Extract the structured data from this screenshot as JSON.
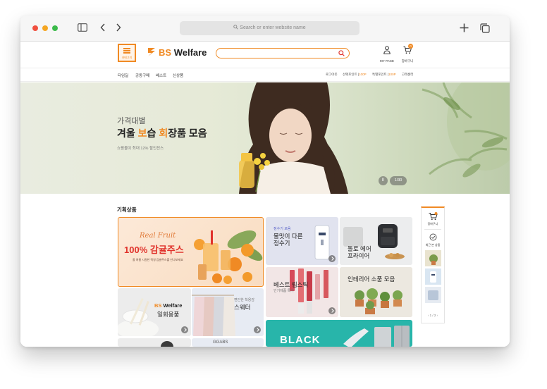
{
  "browser": {
    "address_placeholder": "Search or enter website name"
  },
  "header": {
    "category_label": "카테고리",
    "logo_prefix": "BS",
    "logo_text": "Welfare",
    "my_page": "MY PAGE",
    "cart": "장바구니",
    "cart_count": "0"
  },
  "nav": {
    "left": [
      "타임딜",
      "공동구매",
      "베스트",
      "신상품"
    ],
    "right": {
      "login": "로그아웃",
      "welfare_points_label": "선택포인트 |",
      "welfare_points_value": "100P",
      "special_points_label": "특별포인트 |",
      "special_points_value": "100P",
      "customer_center": "고객센터"
    }
  },
  "hero": {
    "subtitle": "가격대별",
    "title_part1": "겨울 ",
    "title_highlight1": "보",
    "title_part2": "습 ",
    "title_highlight2": "회",
    "title_part3": "장품 모음",
    "description": "쇼핑몰이 최대 12% 할인찬스",
    "pause_label": "II",
    "page_indicator": "1/30"
  },
  "section": {
    "title": "기획상품"
  },
  "tiles": {
    "juice": {
      "script": "Real Fruit",
      "headline": "100% 감귤주스",
      "note": "올 여름 시원한 직영 감귤주스를 만나보세요"
    },
    "water": {
      "prefix": "정수기 모음",
      "title1": "물맛이 다른",
      "title2": "정수기"
    },
    "fryer": {
      "title1": "돌로 에어",
      "title2": "프라이어"
    },
    "welfare": {
      "logo_prefix": "BS",
      "logo_text": "Welfare",
      "title": "일회용품"
    },
    "sweater": {
      "prefix": "편안한 착용감",
      "title": "스웨터"
    },
    "lipstick": {
      "title": "베스트 립스틱",
      "prefix": "인기제품 특가"
    },
    "interior": {
      "title": "인테리어 소품 모음"
    },
    "black": {
      "title": "BLACK"
    },
    "partial": {
      "title": "GGABS"
    }
  },
  "side_panel": {
    "cart_label": "장바구니",
    "recent_label": "최근 본 상품",
    "pager": "1 / 2"
  },
  "colors": {
    "accent": "#f08a24",
    "promo_red": "#e0322b",
    "teal": "#28b5aa"
  }
}
